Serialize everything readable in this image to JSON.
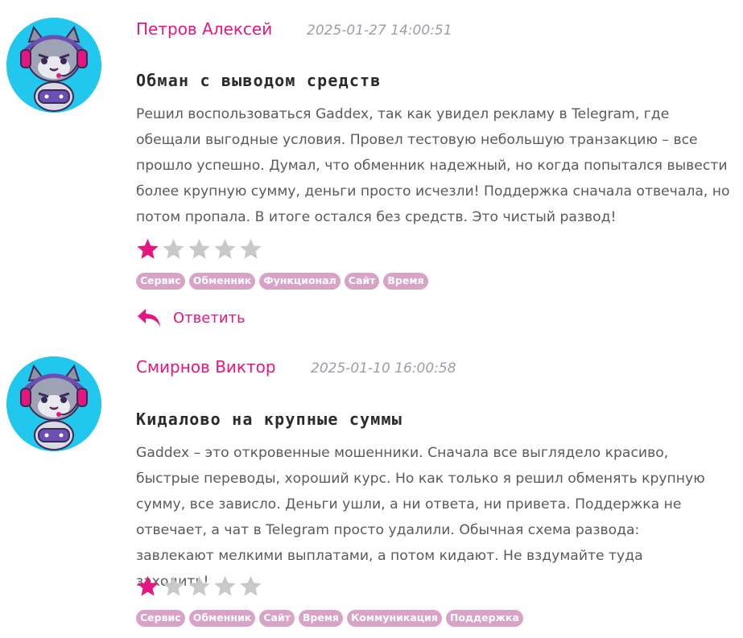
{
  "reviews": [
    {
      "author": "Петров Алексей",
      "date": "2025-01-27 14:00:51",
      "title": "Обман с выводом средств",
      "text": "Решил воспользоваться Gaddex, так как увидел рекламу в Telegram, где обещали выгодные условия. Провел тестовую небольшую транзакцию – все прошло успешно. Думал, что обменник надежный, но когда попытался вывести более крупную сумму, деньги просто исчезли! Поддержка сначала отвечала, но потом пропала. В итоге остался без средств. Это чистый развод!",
      "rating": 1,
      "rating_max": 5,
      "tags": [
        "Сервис",
        "Обменник",
        "Функционал",
        "Сайт",
        "Время"
      ],
      "reply_label": "Ответить"
    },
    {
      "author": "Смирнов Виктор",
      "date": "2025-01-10 16:00:58",
      "title": "Кидалово на крупные суммы",
      "text": "Gaddex – это откровенные мошенники. Сначала все выглядело красиво, быстрые переводы, хороший курс. Но как только я решил обменять крупную сумму, все зависло. Деньги ушли, а ни ответа, ни привета. Поддержка не отвечает, а чат в Telegram просто удалили. Обычная схема развода: завлекают мелкими выплатами, а потом кидают. Не вздумайте туда заходить!",
      "rating": 1,
      "rating_max": 5,
      "tags": [
        "Сервис",
        "Обменник",
        "Сайт",
        "Время",
        "Коммуникация",
        "Поддержка"
      ]
    }
  ],
  "colors": {
    "accent": "#e5167f",
    "star_filled": "#e5167f",
    "star_empty": "#c9c9c9",
    "tag_bg": "#d8a3c7",
    "avatar_bg": "#22c7ee"
  },
  "icons": {
    "avatar": "cat-gamer-avatar-icon",
    "star": "star-icon",
    "reply": "reply-arrow-icon"
  }
}
